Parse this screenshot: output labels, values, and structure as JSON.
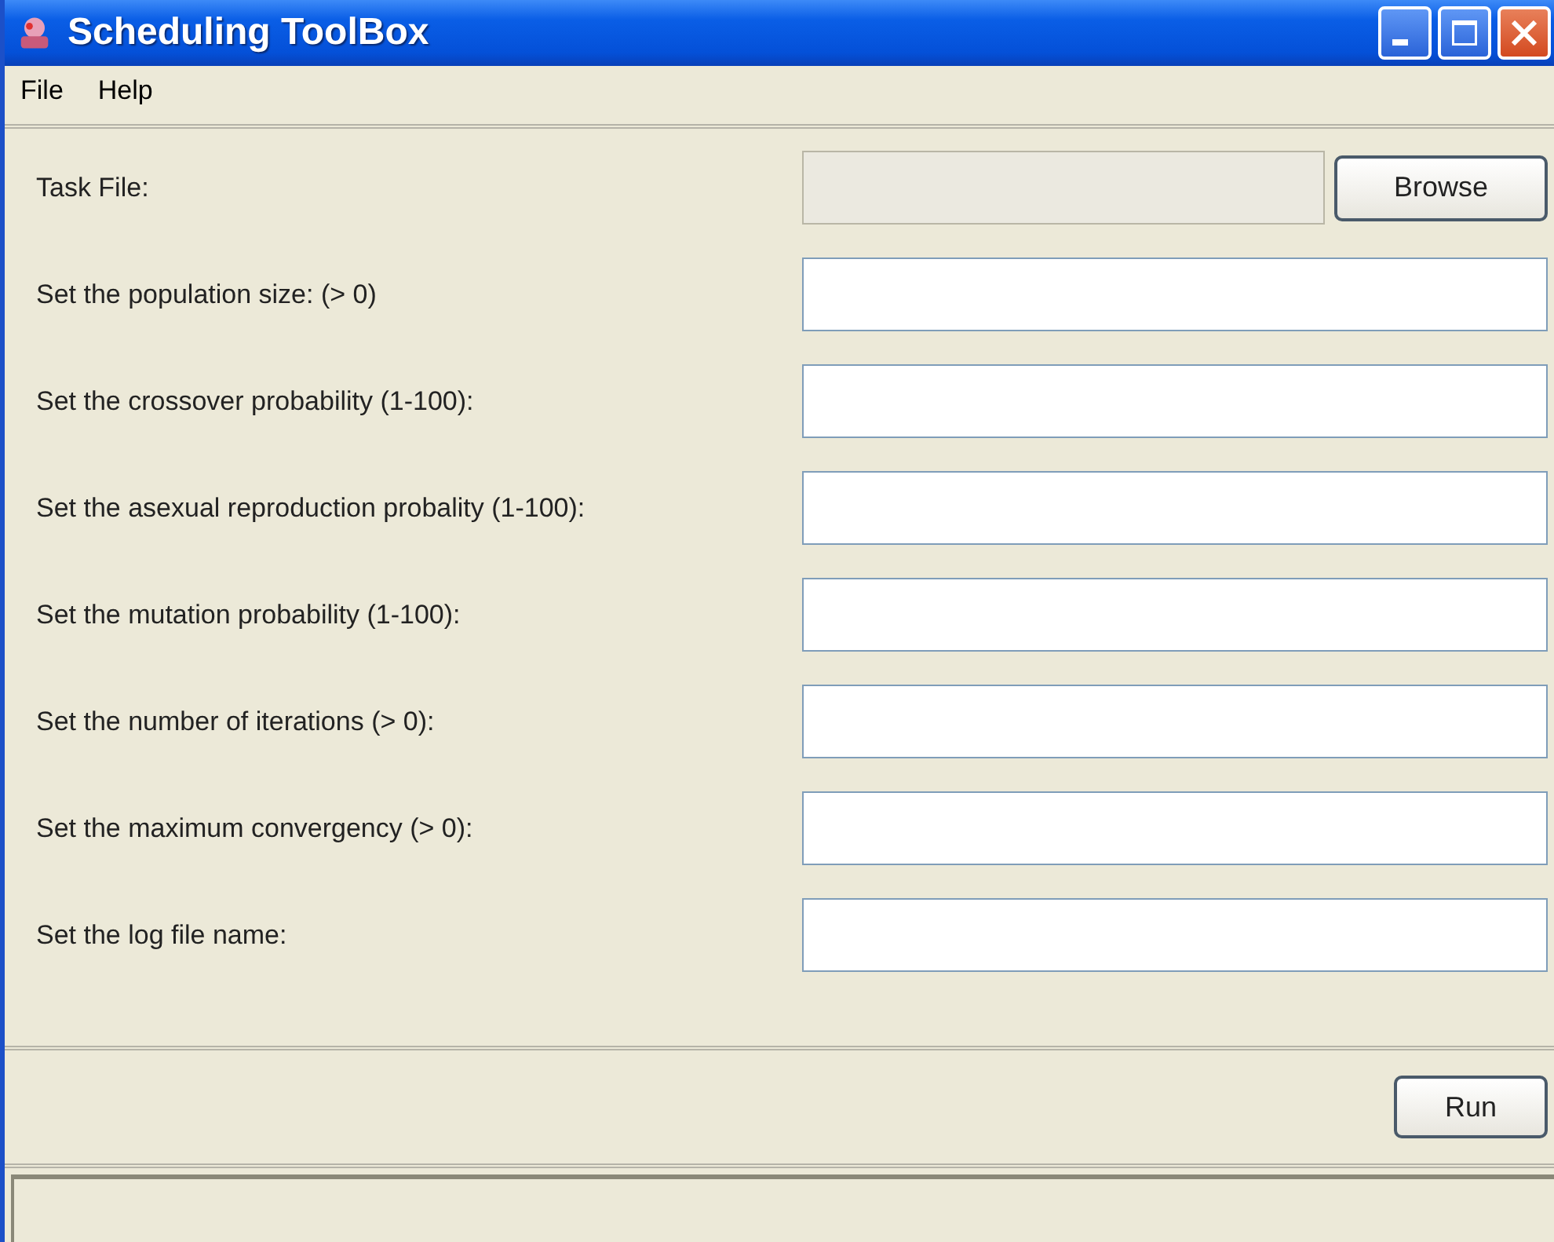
{
  "window": {
    "title": "Scheduling ToolBox"
  },
  "menu": [
    "File",
    "Help"
  ],
  "fields": [
    {
      "kind": "file",
      "label": "Task File:",
      "disabled": true,
      "button": "Browse"
    },
    {
      "kind": "text",
      "label": "Set the population size: (> 0)",
      "disabled": false
    },
    {
      "kind": "text",
      "label": "Set the crossover probability (1-100):",
      "disabled": false
    },
    {
      "kind": "text",
      "label": "Set the asexual reproduction probality (1-100):",
      "disabled": false
    },
    {
      "kind": "text",
      "label": "Set the mutation probability (1-100):",
      "disabled": false
    },
    {
      "kind": "text",
      "label": "Set the number of iterations (> 0):",
      "disabled": false
    },
    {
      "kind": "text",
      "label": "Set the maximum convergency (> 0):",
      "disabled": false
    },
    {
      "kind": "text",
      "label": "Set the log file name:",
      "disabled": false
    }
  ],
  "run_button": "Run"
}
